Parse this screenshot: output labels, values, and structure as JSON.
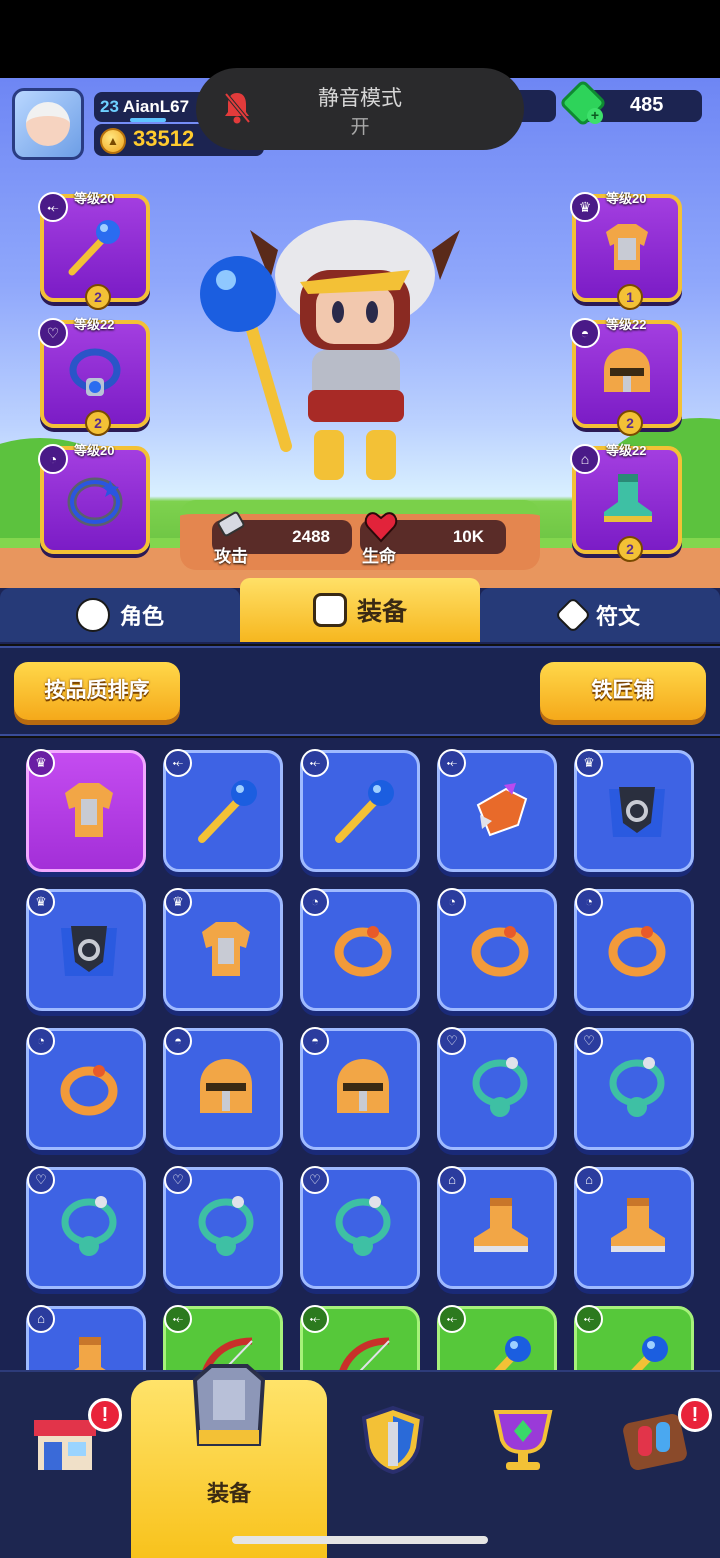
{
  "toast": {
    "title": "静音模式",
    "subtitle": "开"
  },
  "player": {
    "level": "23",
    "name": "AianL67",
    "coins": "33512",
    "gems": "485"
  },
  "slots": {
    "left": [
      {
        "level": "等级20",
        "stars": "2",
        "type": "weapon",
        "icon": "staff-icon"
      },
      {
        "level": "等级22",
        "stars": "2",
        "type": "necklace",
        "icon": "necklace-icon"
      },
      {
        "level": "等级20",
        "stars": "",
        "type": "ring",
        "icon": "ring-icon"
      }
    ],
    "right": [
      {
        "level": "等级20",
        "stars": "1",
        "type": "armor",
        "icon": "armor-icon"
      },
      {
        "level": "等级22",
        "stars": "2",
        "type": "helmet",
        "icon": "helmet-icon"
      },
      {
        "level": "等级22",
        "stars": "2",
        "type": "boots",
        "icon": "boots-icon"
      }
    ]
  },
  "stats": {
    "attack_label": "攻击",
    "attack_value": "2488",
    "hp_label": "生命",
    "hp_value": "10K"
  },
  "tabs": {
    "character": "角色",
    "equipment": "装备",
    "rune": "符文"
  },
  "buttons": {
    "sort": "按品质排序",
    "blacksmith": "铁匠铺"
  },
  "inventory": [
    [
      "armor-icon",
      "staff-icon",
      "staff-icon",
      "gauntlet-icon",
      "cape-armor-icon"
    ],
    [
      "cape-armor-icon",
      "armor-icon",
      "ring-icon",
      "ring-icon",
      "ring-icon"
    ],
    [
      "ring-icon",
      "helmet-icon",
      "helmet-icon",
      "necklace-icon",
      "necklace-icon"
    ],
    [
      "necklace-icon",
      "necklace-icon",
      "necklace-icon",
      "boots-icon",
      "boots-icon"
    ],
    [
      "boots-icon",
      "bow-icon",
      "bow-icon",
      "staff-icon",
      "staff-icon"
    ]
  ],
  "bottom_nav": {
    "active_label": "装备",
    "shop_badge": "!",
    "events_badge": "!"
  },
  "colors": {
    "rare": "#3e63e4",
    "epic": "#c44cf0",
    "uncommon": "#56c83a",
    "gold": "#f3c136"
  }
}
